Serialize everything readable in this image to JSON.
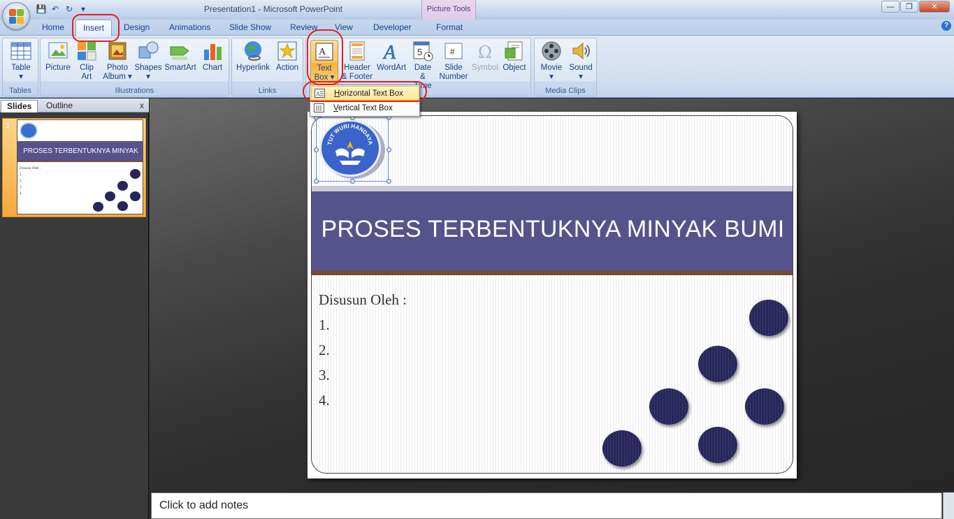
{
  "window": {
    "title": "Presentation1 - Microsoft PowerPoint",
    "context_tab_group": "Picture Tools",
    "controls": {
      "minimize": "—",
      "restore": "❐",
      "close": "✕"
    }
  },
  "qat": {
    "save": "💾",
    "undo": "↶",
    "redo": "↻",
    "more": "▾"
  },
  "tabs": [
    "Home",
    "Insert",
    "Design",
    "Animations",
    "Slide Show",
    "Review",
    "View",
    "Developer",
    "Format"
  ],
  "help": "?",
  "ribbon": {
    "groups": [
      {
        "label": "Tables",
        "buttons": [
          {
            "label": "Table",
            "sub": "▾"
          }
        ]
      },
      {
        "label": "Illustrations",
        "buttons": [
          {
            "label": "Picture"
          },
          {
            "label": "Clip",
            "sub": "Art"
          },
          {
            "label": "Photo",
            "sub": "Album ▾"
          },
          {
            "label": "Shapes",
            "sub": "▾"
          },
          {
            "label": "SmartArt"
          },
          {
            "label": "Chart"
          }
        ]
      },
      {
        "label": "Links",
        "buttons": [
          {
            "label": "Hyperlink"
          },
          {
            "label": "Action"
          }
        ]
      },
      {
        "label": "Text",
        "buttons": [
          {
            "label": "Text",
            "sub": "Box ▾"
          },
          {
            "label": "Header",
            "sub": "& Footer"
          },
          {
            "label": "WordArt",
            "sub": "▾"
          },
          {
            "label": "Date",
            "sub": "& Time"
          },
          {
            "label": "Slide",
            "sub": "Number"
          },
          {
            "label": "Symbol"
          },
          {
            "label": "Object"
          }
        ]
      },
      {
        "label": "Media Clips",
        "buttons": [
          {
            "label": "Movie",
            "sub": "▾"
          },
          {
            "label": "Sound",
            "sub": "▾"
          }
        ]
      }
    ]
  },
  "dropdown": {
    "items": [
      {
        "label": "Horizontal Text Box",
        "accel": "H",
        "rest": "orizontal Text Box",
        "highlighted": true
      },
      {
        "label": "Vertical Text Box",
        "accel": "V",
        "rest": "ertical Text Box",
        "highlighted": false
      }
    ]
  },
  "left_pane": {
    "tabs": [
      "Slides",
      "Outline"
    ],
    "close": "x",
    "slide_number": "1",
    "thumb_title": "PROSES TERBENTUKNYA MINYAK BUMI",
    "thumb_body": "Disusun Oleh :",
    "thumb_list": [
      "1.",
      "2.",
      "3.",
      "4."
    ]
  },
  "slide": {
    "title": "PROSES TERBENTUKNYA MINYAK BUMI",
    "body_heading": "Disusun Oleh :",
    "list": [
      "1.",
      "2.",
      "3.",
      "4."
    ],
    "logo_text": "TUT WURI HANDAYANI"
  },
  "notes": {
    "placeholder": "Click to add notes"
  },
  "colors": {
    "title_band": "#555389",
    "dots": "#262659",
    "highlight": "#ffe38f",
    "annotation": "#e31e24"
  }
}
